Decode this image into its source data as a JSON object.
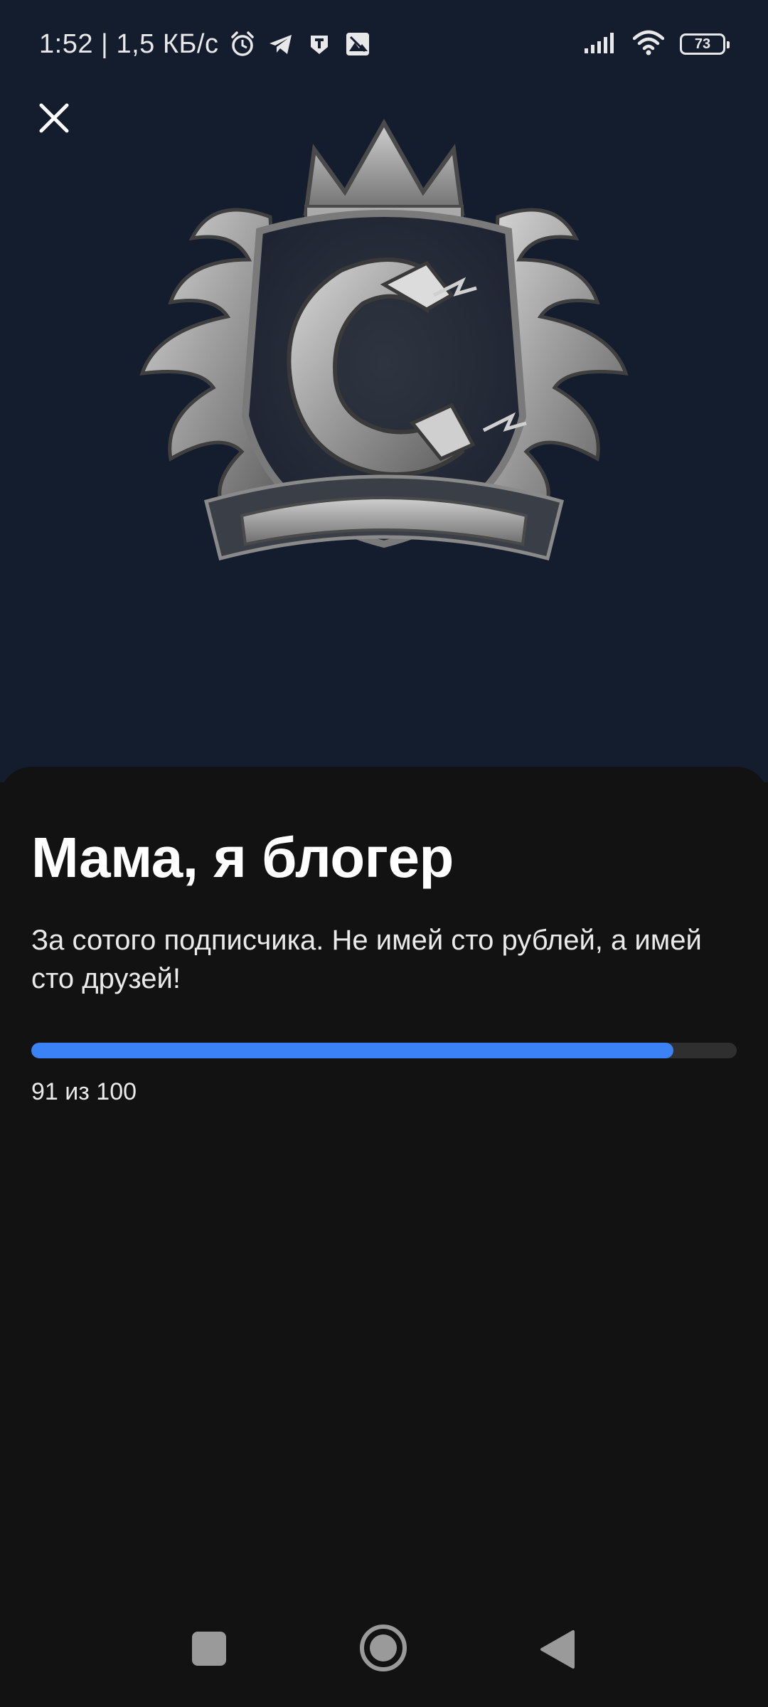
{
  "status_bar": {
    "time_speed": "1:52 | 1,5 КБ/с",
    "battery": "73",
    "icons": [
      "alarm-icon",
      "telegram-icon",
      "shield-app-icon",
      "gallery-app-icon",
      "signal-icon",
      "wifi-icon",
      "battery-icon"
    ]
  },
  "achievement": {
    "title": "Мама, я блогер",
    "description": "За сотого подписчика. Не имей сто рублей, а имей сто друзей!",
    "progress_current": 91,
    "progress_total": 100,
    "progress_label": "91 из 100",
    "badge_icon": "magnet-crest-badge"
  },
  "colors": {
    "header_bg": "#141d2d",
    "sheet_bg": "#121212",
    "progress_fill": "#3b82f6",
    "progress_track": "#2f2f2f"
  },
  "nav_bar": {
    "icons": [
      "recent-apps-icon",
      "home-icon",
      "back-icon"
    ]
  }
}
